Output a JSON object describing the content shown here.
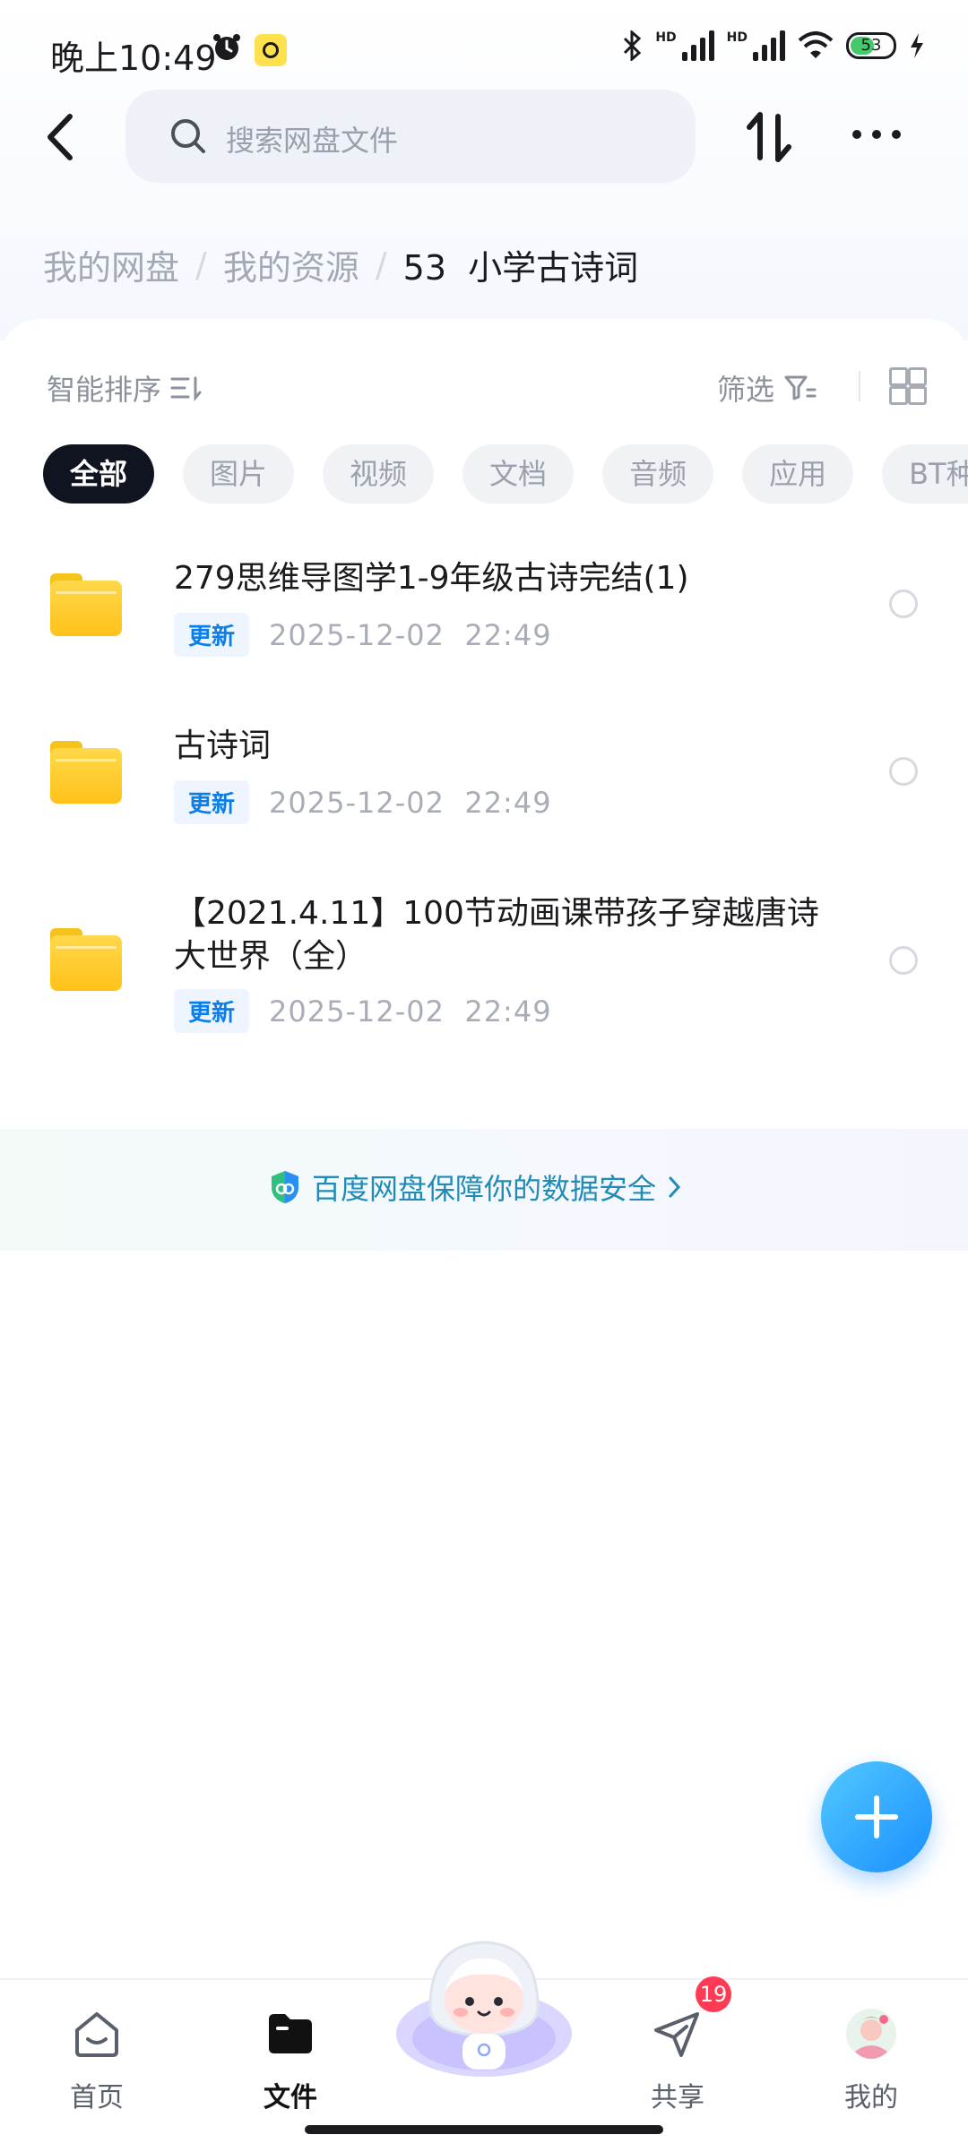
{
  "status_bar": {
    "time": "晚上10:49",
    "battery": "53"
  },
  "header": {
    "search_placeholder": "搜索网盘文件"
  },
  "breadcrumb": {
    "items": [
      "我的网盘",
      "我的资源"
    ],
    "current": "53  小学古诗词"
  },
  "toolbar": {
    "sort_label": "智能排序",
    "filter_label": "筛选"
  },
  "chips": [
    "全部",
    "图片",
    "视频",
    "文档",
    "音频",
    "应用",
    "BT种子"
  ],
  "files": [
    {
      "name": "279思维导图学1-9年级古诗完结(1)",
      "tag": "更新",
      "date": "2025-12-02  22:49"
    },
    {
      "name": "古诗词",
      "tag": "更新",
      "date": "2025-12-02  22:49"
    },
    {
      "name": "【2021.4.11】100节动画课带孩子穿越唐诗大世界（全）",
      "tag": "更新",
      "date": "2025-12-02  22:49"
    }
  ],
  "security_banner": "百度网盘保障你的数据安全",
  "bottom_nav": {
    "home": "首页",
    "files": "文件",
    "share": "共享",
    "share_badge": "19",
    "mine": "我的"
  },
  "colors": {
    "accent": "#0d7ee6",
    "fab": "#1a8fff",
    "folder": "#ffc21a"
  }
}
